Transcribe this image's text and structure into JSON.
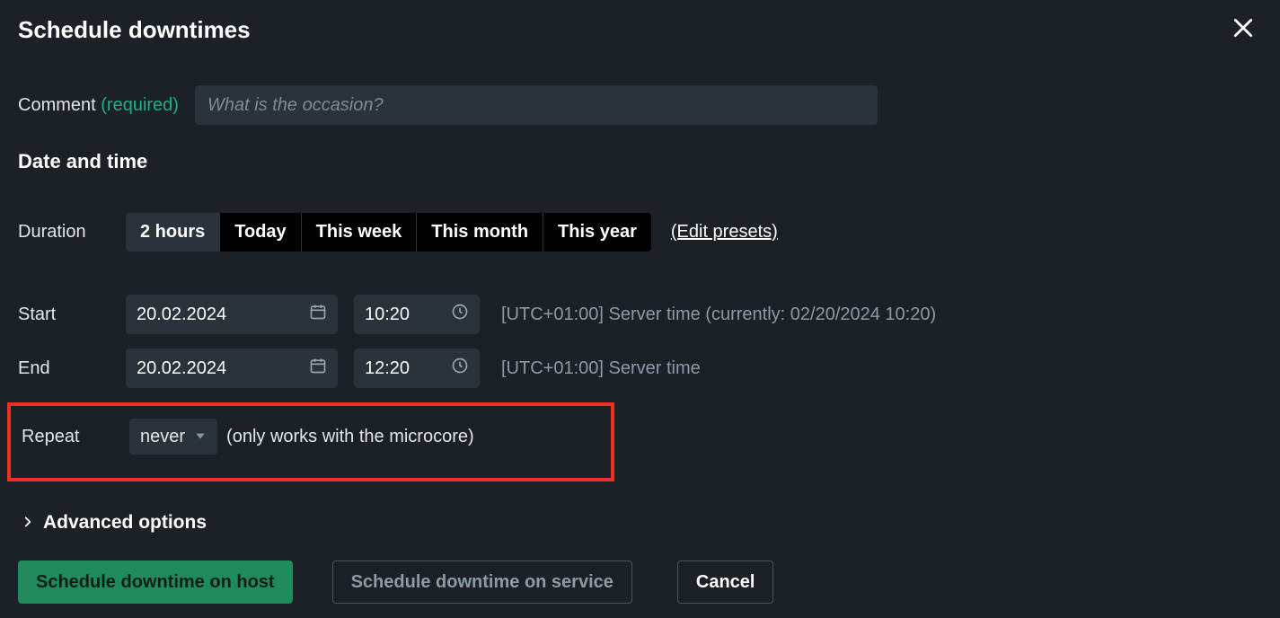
{
  "dialog": {
    "title": "Schedule downtimes"
  },
  "comment": {
    "label": "Comment",
    "required_text": "(required)",
    "placeholder": "What is the occasion?",
    "value": ""
  },
  "datetime_section": {
    "heading": "Date and time"
  },
  "duration": {
    "label": "Duration",
    "presets": [
      "2 hours",
      "Today",
      "This week",
      "This month",
      "This year"
    ],
    "active_index": 0,
    "edit_presets_label": "(Edit presets)"
  },
  "start": {
    "label": "Start",
    "date": "20.02.2024",
    "time": "10:20",
    "tz_note": "[UTC+01:00] Server time (currently: 02/20/2024 10:20)"
  },
  "end": {
    "label": "End",
    "date": "20.02.2024",
    "time": "12:20",
    "tz_note": "[UTC+01:00] Server time"
  },
  "repeat": {
    "label": "Repeat",
    "value": "never",
    "note": "(only works with the microcore)"
  },
  "advanced": {
    "label": "Advanced options"
  },
  "buttons": {
    "schedule_host": "Schedule downtime on host",
    "schedule_service": "Schedule downtime on service",
    "cancel": "Cancel"
  }
}
